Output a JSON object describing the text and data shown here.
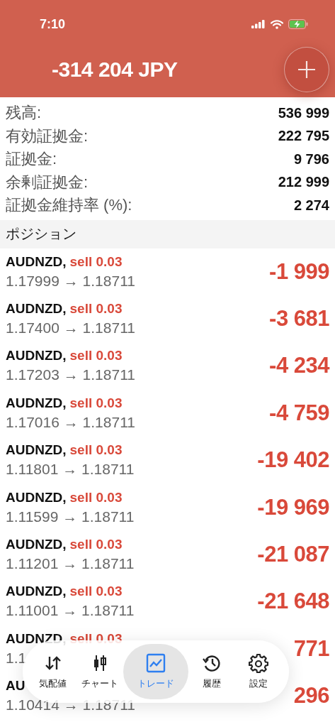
{
  "status_bar": {
    "time": "7:10"
  },
  "header": {
    "balance": "-314 204 JPY"
  },
  "summary": [
    {
      "label": "残高:",
      "value": "536 999"
    },
    {
      "label": "有効証拠金:",
      "value": "222 795"
    },
    {
      "label": "証拠金:",
      "value": "9 796"
    },
    {
      "label": "余剰証拠金:",
      "value": "212 999"
    },
    {
      "label": "証拠金維持率 (%):",
      "value": "2 274"
    }
  ],
  "section_title": "ポジション",
  "positions": [
    {
      "symbol": "AUDNZD,",
      "side": "sell 0.03",
      "prices": "1.17999 → 1.18711",
      "profit": "-1 999"
    },
    {
      "symbol": "AUDNZD,",
      "side": "sell 0.03",
      "prices": "1.17400 → 1.18711",
      "profit": "-3 681"
    },
    {
      "symbol": "AUDNZD,",
      "side": "sell 0.03",
      "prices": "1.17203 → 1.18711",
      "profit": "-4 234"
    },
    {
      "symbol": "AUDNZD,",
      "side": "sell 0.03",
      "prices": "1.17016 → 1.18711",
      "profit": "-4 759"
    },
    {
      "symbol": "AUDNZD,",
      "side": "sell 0.03",
      "prices": "1.11801 → 1.18711",
      "profit": "-19 402"
    },
    {
      "symbol": "AUDNZD,",
      "side": "sell 0.03",
      "prices": "1.11599 → 1.18711",
      "profit": "-19 969"
    },
    {
      "symbol": "AUDNZD,",
      "side": "sell 0.03",
      "prices": "1.11201 → 1.18711",
      "profit": "-21 087"
    },
    {
      "symbol": "AUDNZD,",
      "side": "sell 0.03",
      "prices": "1.11001 → 1.18711",
      "profit": "-21 648"
    },
    {
      "symbol": "AUDNZD,",
      "side": "sell 0.03",
      "prices": "1.1",
      "profit": "771"
    },
    {
      "symbol": "AU",
      "prices": "1.10414 → 1.18711",
      "profit": "296"
    }
  ],
  "tab_bar": [
    {
      "label": "気配値",
      "kind": "quotes",
      "selected": false
    },
    {
      "label": "チャート",
      "kind": "chart",
      "selected": false
    },
    {
      "label": "トレード",
      "kind": "trade",
      "selected": true
    },
    {
      "label": "履歴",
      "kind": "history",
      "selected": false
    },
    {
      "label": "設定",
      "kind": "settings",
      "selected": false
    }
  ]
}
